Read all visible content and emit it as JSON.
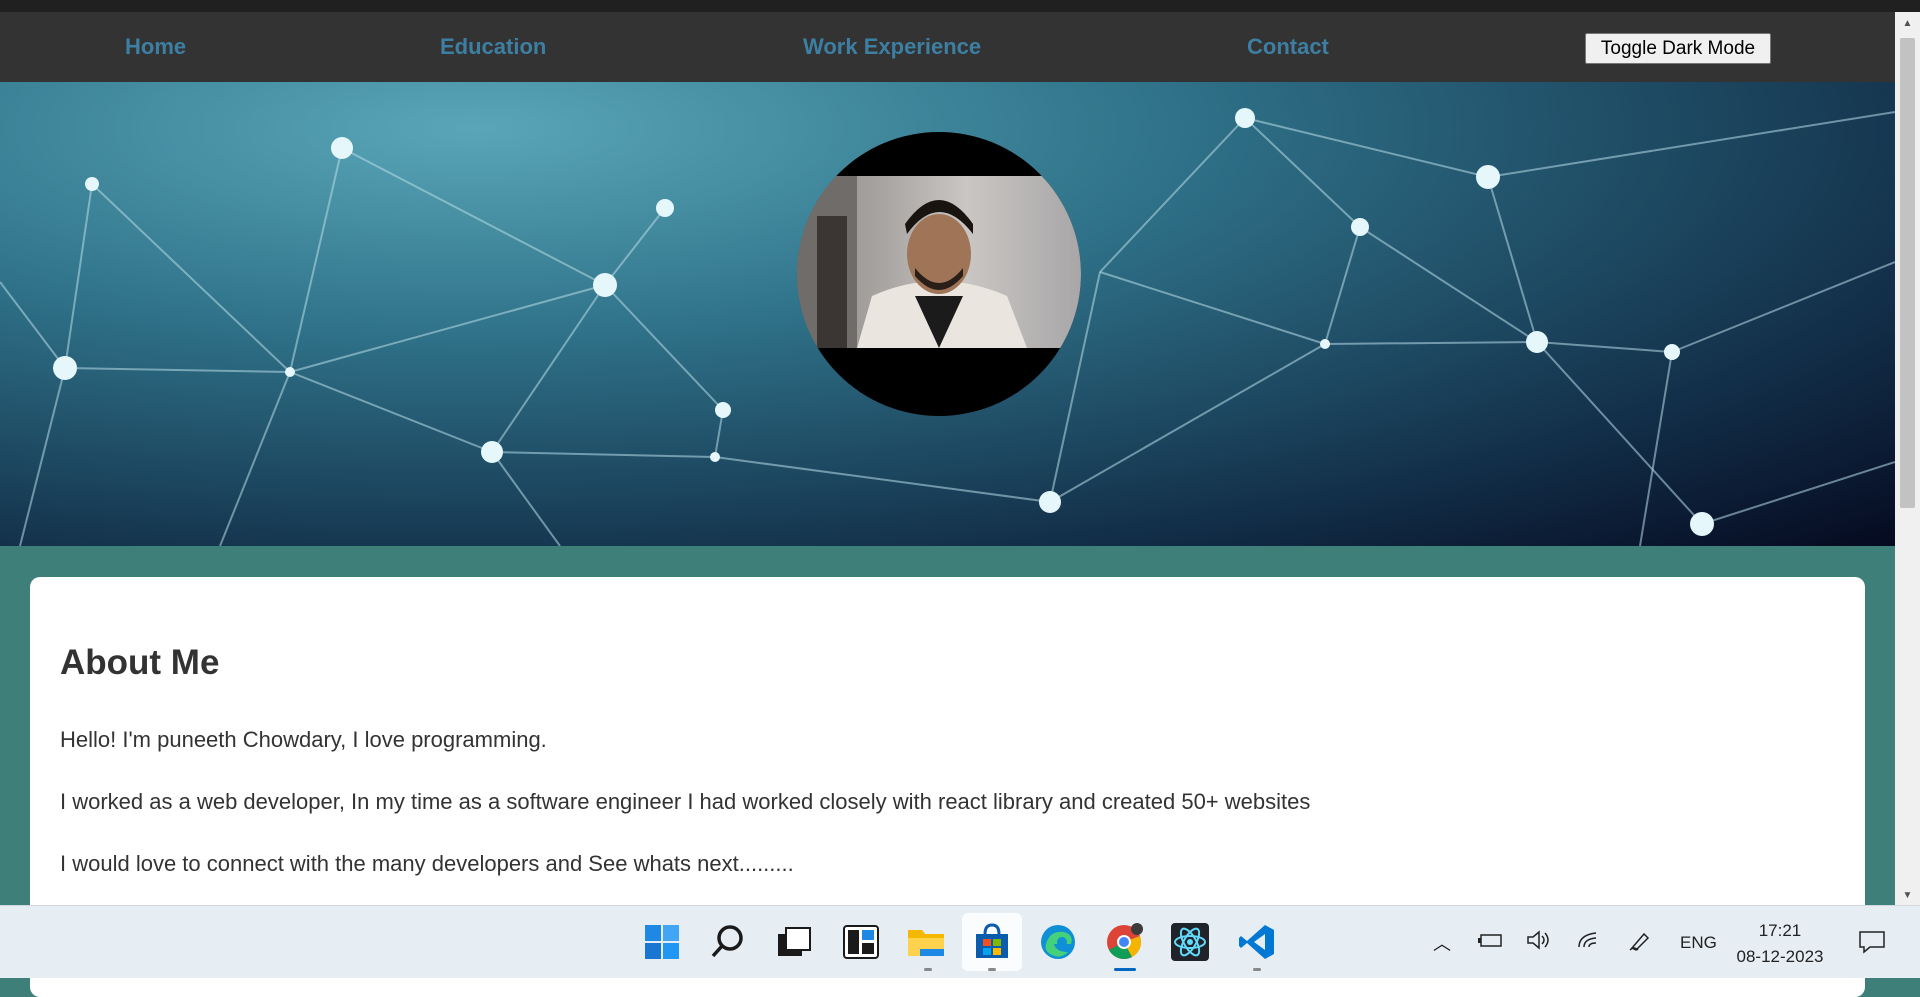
{
  "nav": {
    "home": "Home",
    "education": "Education",
    "work_experience": "Work Experience",
    "contact": "Contact",
    "toggle_dark_mode": "Toggle Dark Mode"
  },
  "about": {
    "heading": "About Me",
    "paragraphs": [
      "Hello! I'm puneeth Chowdary, I love programming.",
      "I worked as a web developer, In my time as a software engineer I had worked closely with react library and created 50+ websites",
      "I would love to connect with the many developers and See whats next........."
    ]
  },
  "taskbar": {
    "icons": [
      "windows-start-icon",
      "search-icon",
      "task-view-icon",
      "widgets-icon",
      "file-explorer-icon",
      "microsoft-store-icon",
      "edge-icon",
      "chrome-icon",
      "react-devtools-icon",
      "vscode-icon"
    ],
    "tray": {
      "language": "ENG",
      "time": "17:21",
      "date": "08-12-2023"
    }
  },
  "colors": {
    "nav_bg": "#333333",
    "nav_link": "#3d7fa3",
    "page_bg": "#3e7f7a",
    "card_bg": "#ffffff"
  }
}
